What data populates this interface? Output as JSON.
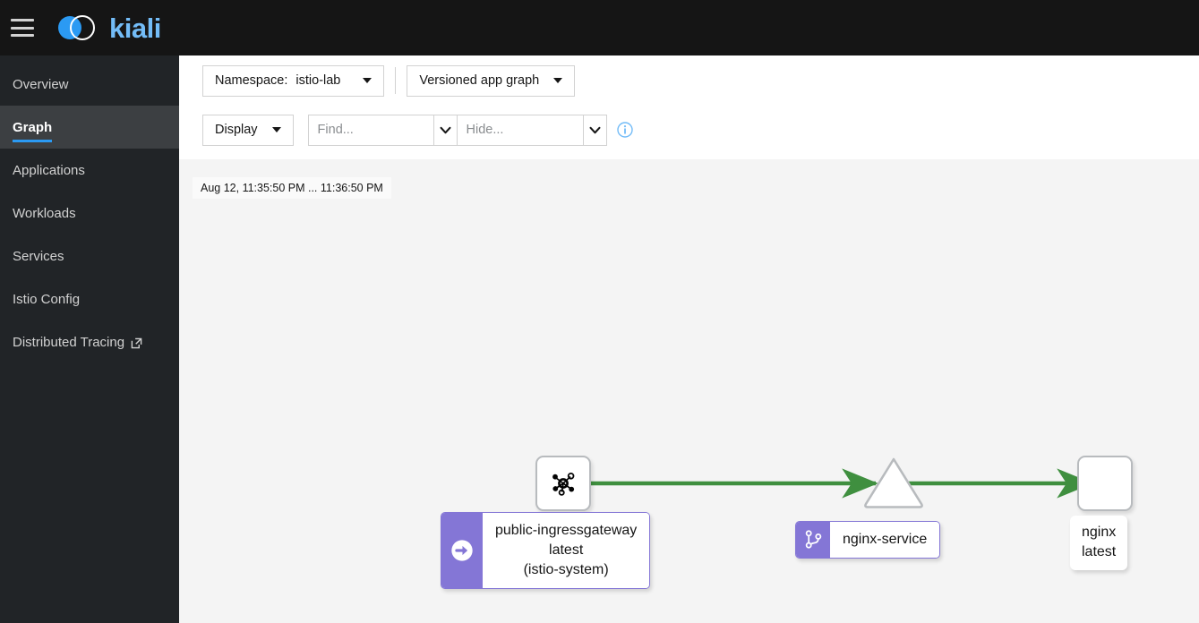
{
  "header": {
    "menu_icon": "hamburger-icon",
    "logo_icon": "kiali-logo-icon",
    "brand": "kiali",
    "brand_color": "#73bcf7"
  },
  "sidebar": {
    "items": [
      {
        "label": "Overview",
        "active": false,
        "external": false
      },
      {
        "label": "Graph",
        "active": true,
        "external": false
      },
      {
        "label": "Applications",
        "active": false,
        "external": false
      },
      {
        "label": "Workloads",
        "active": false,
        "external": false
      },
      {
        "label": "Services",
        "active": false,
        "external": false
      },
      {
        "label": "Istio Config",
        "active": false,
        "external": false
      },
      {
        "label": "Distributed Tracing",
        "active": false,
        "external": true
      }
    ],
    "active_accent": "#2b9af3"
  },
  "toolbar": {
    "namespace_label": "Namespace:",
    "namespace_value": "istio-lab",
    "graph_type": "Versioned app graph",
    "display_label": "Display",
    "find_placeholder": "Find...",
    "find_value": "",
    "hide_placeholder": "Hide...",
    "hide_value": "",
    "info_icon": "info-circle-icon",
    "find_chevron_icon": "chevron-down-icon",
    "hide_chevron_icon": "chevron-down-icon",
    "namespace_caret_icon": "caret-down-icon",
    "graphtype_caret_icon": "caret-down-icon",
    "display_caret_icon": "caret-down-icon"
  },
  "graph": {
    "time_range": "Aug 12, 11:35:50 PM ... 11:36:50 PM",
    "edge_color": "#3f8f3f",
    "badge_color": "#8476d6",
    "nodes": [
      {
        "id": "ingressgateway",
        "shape": "rounded-square",
        "icon": "topology-mesh-icon",
        "badge_icon": "gateway-arrow-icon",
        "label": "public-ingressgateway\nlatest\n(istio-system)"
      },
      {
        "id": "nginx-service",
        "shape": "triangle",
        "badge_icon": "code-branch-icon",
        "label": "nginx-service"
      },
      {
        "id": "nginx-app",
        "shape": "rounded-square",
        "label": "nginx\nlatest"
      }
    ],
    "edges": [
      {
        "from": "ingressgateway",
        "to": "nginx-service"
      },
      {
        "from": "nginx-service",
        "to": "nginx-app"
      }
    ]
  }
}
